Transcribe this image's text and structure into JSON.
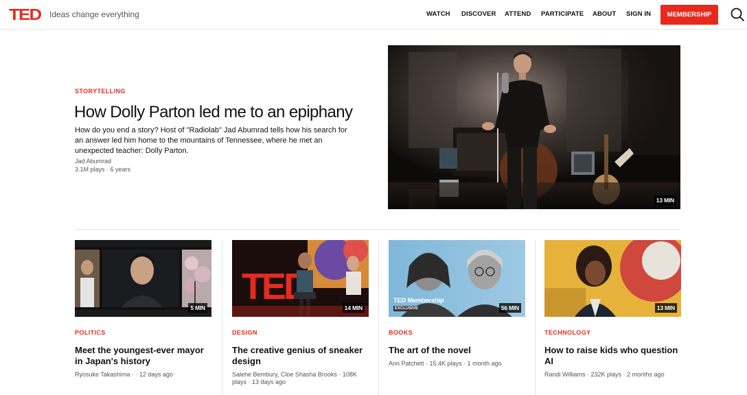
{
  "header": {
    "logo": "TED",
    "tagline": "Ideas change everything",
    "nav": [
      "WATCH",
      "DISCOVER",
      "ATTEND",
      "PARTICIPATE",
      "ABOUT",
      "SIGN IN"
    ],
    "membership_label": "MEMBERSHIP",
    "search_icon": "search-icon"
  },
  "hero": {
    "category": "STORYTELLING",
    "title": "How Dolly Parton led me to an epiphany",
    "description": "How do you end a story? Host of \"Radiolab\" Jad Abumrad tells how his search for an answer led him home to the mountains of Tennessee, where he met an unexpected teacher: Dolly Parton.",
    "speaker": "Jad Abumrad",
    "meta": "3.1M plays · 6 years",
    "duration": "13 MIN"
  },
  "cards": [
    {
      "category": "POLITICS",
      "title": "Meet the youngest-ever mayor in Japan's history",
      "meta": "Ryosuke Takashima · · 12 days ago",
      "duration": "5 MIN"
    },
    {
      "category": "DESIGN",
      "title": "The creative genius of sneaker design",
      "meta": "Salehe Bembury, Cloe Shasha Brooks · 108K plays · 13 days ago",
      "duration": "14 MIN"
    },
    {
      "category": "BOOKS",
      "title": "The art of the novel",
      "meta": "Ann Patchett · 15.4K plays · 1 month ago",
      "duration": "56 MIN",
      "badge": "TED Membership",
      "badge_sub": "EXCLUSIVE"
    },
    {
      "category": "TECHNOLOGY",
      "title": "How to raise kids who question AI",
      "meta": "Randi Williams · 232K plays · 2 months ago",
      "duration": "13 MIN"
    }
  ],
  "colors": {
    "brand_red": "#e62b1e",
    "text": "#111111",
    "muted": "#555555",
    "divider": "#e3e3e3"
  }
}
